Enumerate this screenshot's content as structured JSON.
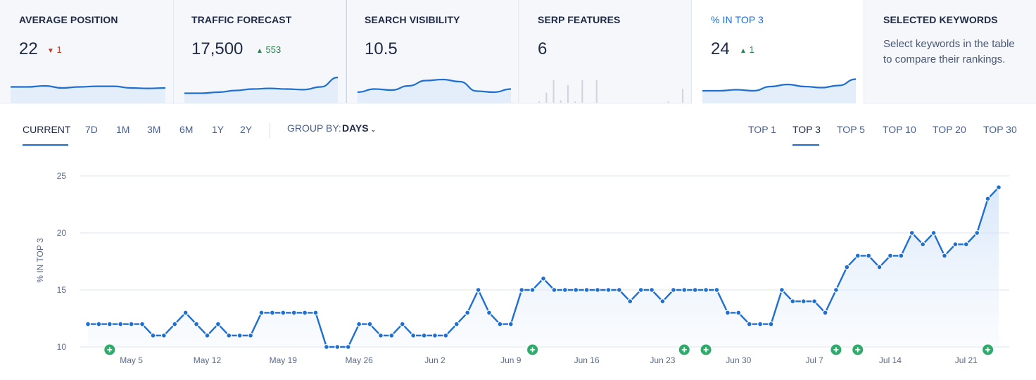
{
  "kpis": [
    {
      "title": "AVERAGE POSITION",
      "value": "22",
      "delta": "1",
      "delta_dir": "down",
      "spark": [
        0.55,
        0.55,
        0.6,
        0.5,
        0.55,
        0.58,
        0.58,
        0.5,
        0.48,
        0.5
      ]
    },
    {
      "title": "TRAFFIC FORECAST",
      "value": "17,500",
      "delta": "553",
      "delta_dir": "up",
      "spark": [
        0.25,
        0.25,
        0.3,
        0.38,
        0.45,
        0.48,
        0.45,
        0.42,
        0.55,
        1.0
      ]
    },
    {
      "title": "SEARCH VISIBILITY",
      "value": "10.5",
      "delta": "",
      "delta_dir": "",
      "spark": [
        0.3,
        0.45,
        0.4,
        0.6,
        0.85,
        0.9,
        0.8,
        0.35,
        0.3,
        0.45
      ]
    },
    {
      "title": "SERP FEATURES",
      "value": "6",
      "delta": "",
      "delta_dir": "",
      "bars": [
        0,
        0.05,
        0.4,
        0.9,
        0.1,
        0.7,
        0.05,
        0.9,
        0,
        0.9,
        0,
        0,
        0,
        0,
        0,
        0,
        0,
        0,
        0,
        0.05,
        0,
        0.55
      ]
    },
    {
      "title": "% IN TOP 3",
      "value": "24",
      "delta": "1",
      "delta_dir": "up",
      "spark": [
        0.4,
        0.4,
        0.45,
        0.4,
        0.6,
        0.7,
        0.6,
        0.55,
        0.65,
        0.95
      ]
    },
    {
      "title": "SELECTED KEYWORDS",
      "desc": "Select keywords in the table to compare their rankings."
    }
  ],
  "period_tabs": [
    "CURRENT",
    "7D",
    "1M",
    "3M",
    "6M",
    "1Y",
    "2Y"
  ],
  "period_selected": "CURRENT",
  "group_by": {
    "label": "GROUP BY:",
    "value": "DAYS"
  },
  "top_tabs": [
    "TOP 1",
    "TOP 3",
    "TOP 5",
    "TOP 10",
    "TOP 20",
    "TOP 30"
  ],
  "top_selected": "TOP 3",
  "colors": {
    "accent": "#1b6ad6",
    "line": "#1e6fd0",
    "fill": "#dceaf9",
    "marker": "#2eaa6b",
    "up": "#2e7d4f",
    "down": "#c0392b"
  },
  "chart_data": {
    "type": "line",
    "ylabel": "% IN TOP 3",
    "ylim": [
      10,
      25
    ],
    "yticks": [
      10,
      15,
      20,
      25
    ],
    "x_labels": [
      "May 5",
      "May 12",
      "May 19",
      "May 26",
      "Jun 2",
      "Jun 9",
      "Jun 16",
      "Jun 23",
      "Jun 30",
      "Jul 7",
      "Jul 14",
      "Jul 21"
    ],
    "x_label_index": [
      4,
      11,
      18,
      25,
      32,
      39,
      46,
      53,
      60,
      67,
      74,
      81
    ],
    "start_label_index": 4,
    "values": [
      12,
      12,
      12,
      12,
      12,
      12,
      11,
      11,
      12,
      13,
      12,
      11,
      12,
      11,
      11,
      11,
      13,
      13,
      13,
      13,
      13,
      13,
      10,
      10,
      10,
      12,
      12,
      11,
      11,
      12,
      11,
      11,
      11,
      11,
      12,
      13,
      15,
      13,
      12,
      12,
      15,
      15,
      16,
      15,
      15,
      15,
      15,
      15,
      15,
      15,
      14,
      15,
      15,
      14,
      15,
      15,
      15,
      15,
      15,
      13,
      13,
      12,
      12,
      12,
      15,
      14,
      14,
      14,
      13,
      15,
      17,
      18,
      18,
      17,
      18,
      18,
      20,
      19,
      20,
      18,
      19,
      19,
      20,
      23,
      24
    ],
    "event_markers": [
      2,
      41,
      55,
      57,
      69,
      71,
      83
    ]
  }
}
